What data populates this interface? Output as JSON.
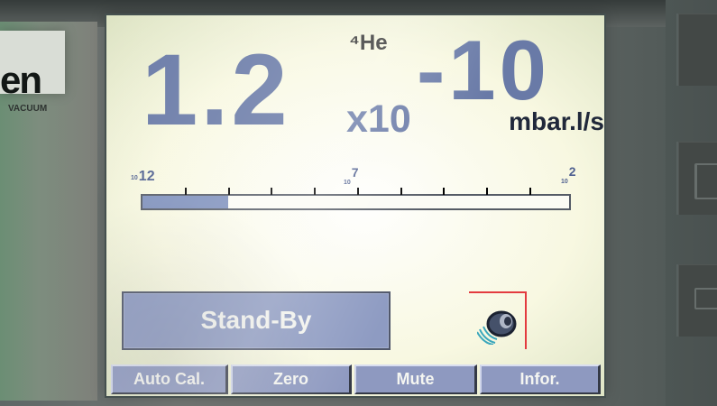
{
  "brand": {
    "mark": "en",
    "subtitle": "VACUUM"
  },
  "display": {
    "gas": "⁴He",
    "mantissa": "1.2",
    "multiplier": "x10",
    "exponent": "-10",
    "unit": "mbar.l/s"
  },
  "scale": {
    "left_base": "10",
    "left_exponent": "12",
    "middle_base": "10",
    "middle_exponent": "7",
    "right_base": "10",
    "right_exponent": "2",
    "fill_fraction": 0.2
  },
  "status": {
    "label": "Stand-By"
  },
  "softkeys": [
    {
      "label": "Auto Cal."
    },
    {
      "label": "Zero"
    },
    {
      "label": "Mute"
    },
    {
      "label": "Infor."
    }
  ],
  "icons": {
    "sound": "speaker-icon"
  },
  "colors": {
    "screen_blue": "#697aa7",
    "button_blue": "#8e99c0",
    "alert_red": "#e33b3f"
  }
}
